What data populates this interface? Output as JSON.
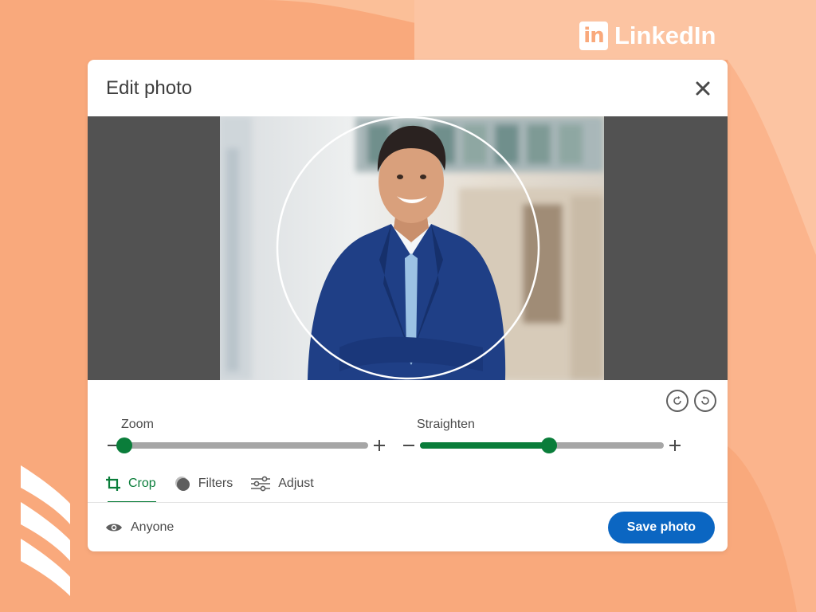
{
  "brand": {
    "badge": "in",
    "name": "LinkedIn"
  },
  "modal": {
    "title": "Edit photo"
  },
  "controls": {
    "zoom": {
      "label": "Zoom",
      "value": 0.0
    },
    "straighten": {
      "label": "Straighten",
      "value": 0.53
    }
  },
  "tabs": [
    {
      "label": "Crop",
      "icon": "crop-icon",
      "active": true
    },
    {
      "label": "Filters",
      "icon": "filters-icon",
      "active": false
    },
    {
      "label": "Adjust",
      "icon": "sliders-icon",
      "active": false
    }
  ],
  "footer": {
    "visibility": "Anyone",
    "save_label": "Save photo"
  },
  "colors": {
    "background": "#f9a97c",
    "accent_green": "#0a7d3a",
    "primary_blue": "#0b66c2",
    "photo_backdrop": "#525252"
  }
}
